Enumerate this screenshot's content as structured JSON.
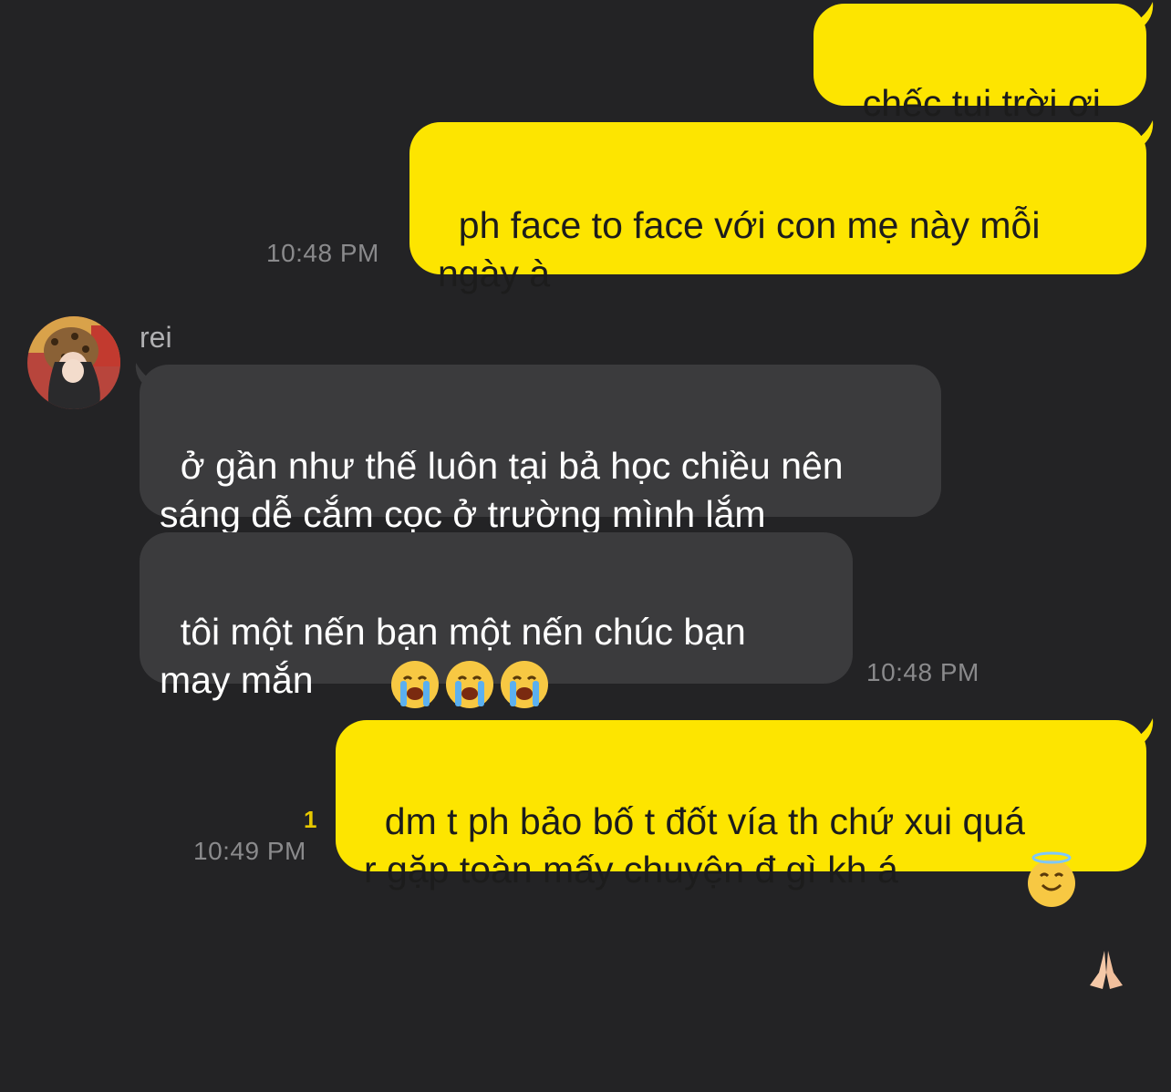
{
  "messages": {
    "m1": "chếc tui trời ơi",
    "m2": "ph face to face với con mẹ này mỗi\nngày à",
    "m2_time": "10:48 PM",
    "sender": "rei",
    "r1": "ở gần như thế luôn tại bả học chiều nên\nsáng dễ cắm cọc ở trường mình lắm",
    "r2": "tôi một nến bạn một nến chúc bạn\nmay mắn",
    "r_time": "10:48 PM",
    "m3": "dm t ph bảo bố t đốt vía th chứ xui quá\nr gặp toàn mấy chuyện đ gì kh á",
    "m3_unread": "1",
    "m3_time": "10:49 PM"
  },
  "icons": {
    "crying": "loudly-crying-face-emoji",
    "halo": "smiling-face-with-halo-emoji",
    "pray": "folded-hands-emoji"
  },
  "colors": {
    "background": "#232325",
    "outgoing_bubble": "#fde500",
    "incoming_bubble": "#3b3b3d"
  }
}
